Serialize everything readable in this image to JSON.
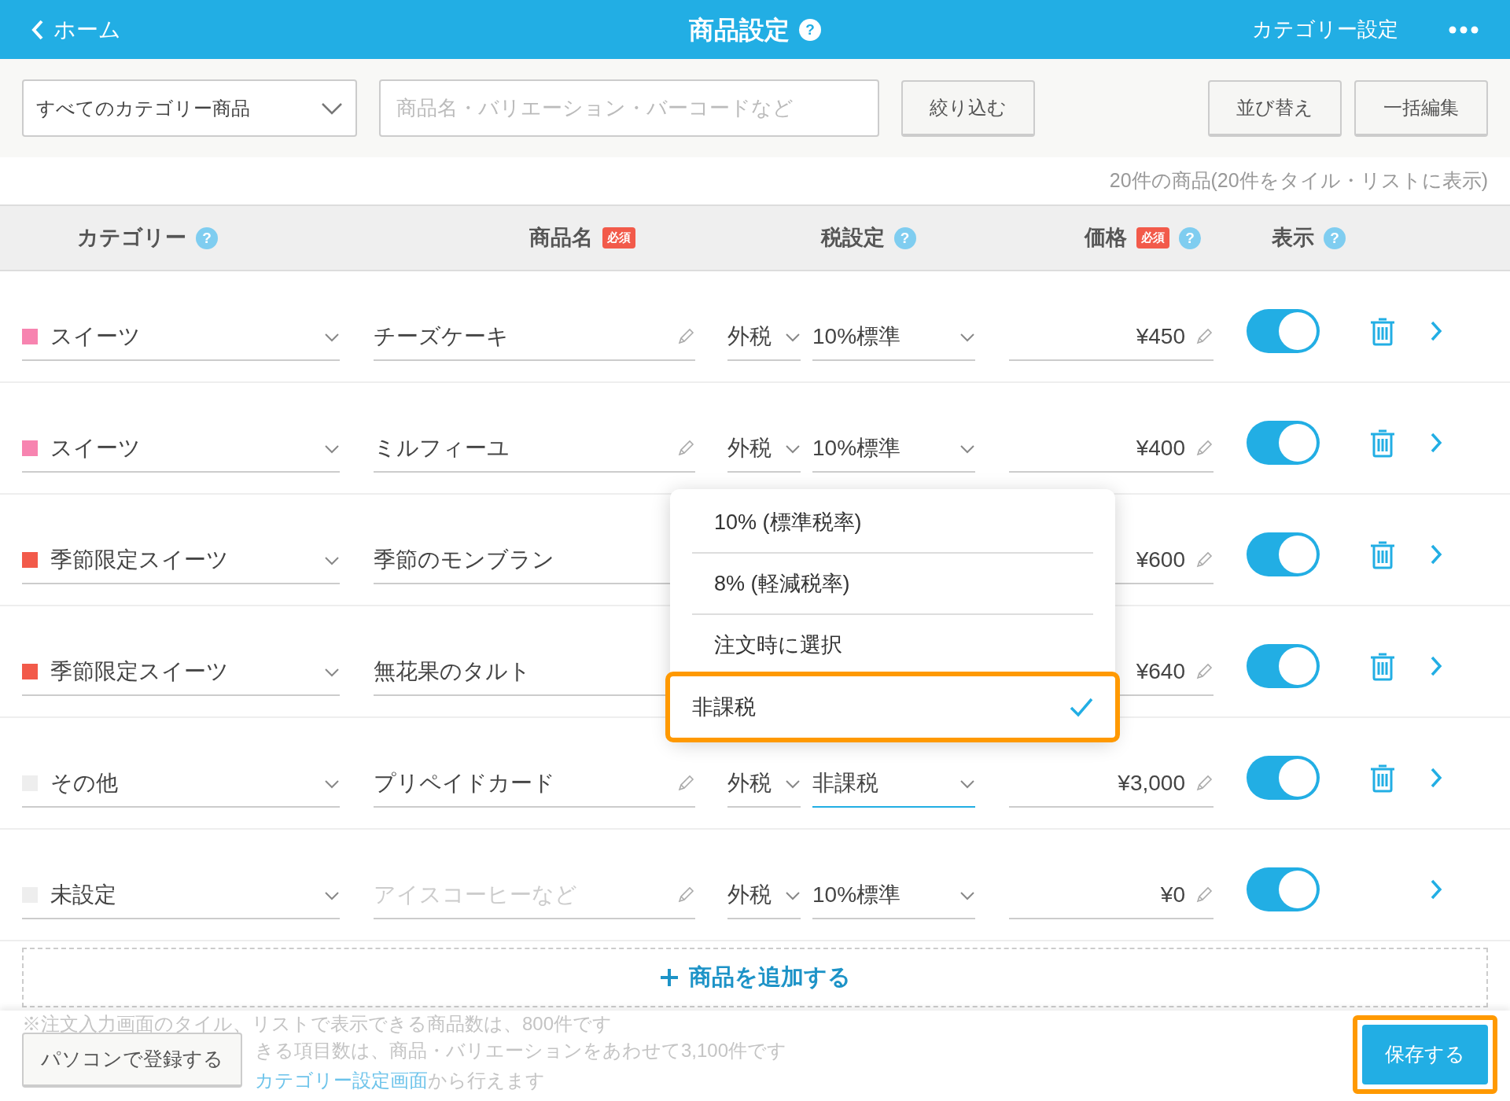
{
  "header": {
    "back_label": "ホーム",
    "title": "商品設定",
    "right_link": "カテゴリー設定"
  },
  "toolbar": {
    "category_filter": "すべてのカテゴリー商品",
    "search": {
      "placeholder": "商品名・バリエーション・バーコードなど"
    },
    "filter_button": "絞り込む",
    "sort_button": "並び替え",
    "bulk_edit_button": "一括編集"
  },
  "count_text": "20件の商品(20件をタイル・リストに表示)",
  "header_help": "?",
  "columns": [
    {
      "label": "カテゴリー",
      "help": "?"
    },
    {
      "label": "商品名",
      "badge": "必須"
    },
    {
      "label": "税設定",
      "help": "?"
    },
    {
      "label": "価格",
      "badge": "必須",
      "help": "?"
    },
    {
      "label": "表示",
      "help": "?"
    }
  ],
  "rows": [
    {
      "category": "スイーツ",
      "color": "#f784b0",
      "name": "チーズケーキ",
      "name_is_placeholder": false,
      "tax_type": "外税",
      "tax_rate": "10%標準",
      "tax_rate_focused": false,
      "price": "¥450",
      "visible": true,
      "deletable": true
    },
    {
      "category": "スイーツ",
      "color": "#f784b0",
      "name": "ミルフィーユ",
      "name_is_placeholder": false,
      "tax_type": "外税",
      "tax_rate": "10%標準",
      "tax_rate_focused": false,
      "price": "¥400",
      "visible": true,
      "deletable": true
    },
    {
      "category": "季節限定スイーツ",
      "color": "#f25a4a",
      "name": "季節のモンブラン",
      "name_is_placeholder": false,
      "price": "¥600",
      "visible": true,
      "deletable": true
    },
    {
      "category": "季節限定スイーツ",
      "color": "#f25a4a",
      "name": "無花果のタルト",
      "name_is_placeholder": false,
      "price": "¥640",
      "visible": true,
      "deletable": true
    },
    {
      "category": "その他",
      "color": "#eeeeee",
      "name": "プリペイドカード",
      "name_is_placeholder": false,
      "tax_type": "外税",
      "tax_rate": "非課税",
      "tax_rate_focused": true,
      "price": "¥3,000",
      "visible": true,
      "deletable": true
    },
    {
      "category": "未設定",
      "color": "#eeeeee",
      "name": "アイスコーヒーなど",
      "name_is_placeholder": true,
      "tax_type": "外税",
      "tax_rate": "10%標準",
      "tax_rate_focused": false,
      "price": "¥0",
      "visible": true,
      "deletable": false
    }
  ],
  "tax_dropdown": [
    {
      "label": "10% (標準税率)",
      "selected": false
    },
    {
      "label": "8% (軽減税率)",
      "selected": false
    },
    {
      "label": "注文時に選択",
      "selected": false
    },
    {
      "label": "非課税",
      "selected": true
    }
  ],
  "add_button": "商品を追加する",
  "notes": [
    {
      "text": "※注文入力画面のタイル、リストで表示できる商品数は、800件です"
    },
    {
      "text": "きる項目数は、商品・バリエーションをあわせて3,100件です"
    },
    {
      "link": "カテゴリー設定画面",
      "text": "から行えます"
    }
  ],
  "footer": {
    "pc_button": "パソコンで登録する",
    "save_button": "保存する",
    "save_highlighted": true
  }
}
